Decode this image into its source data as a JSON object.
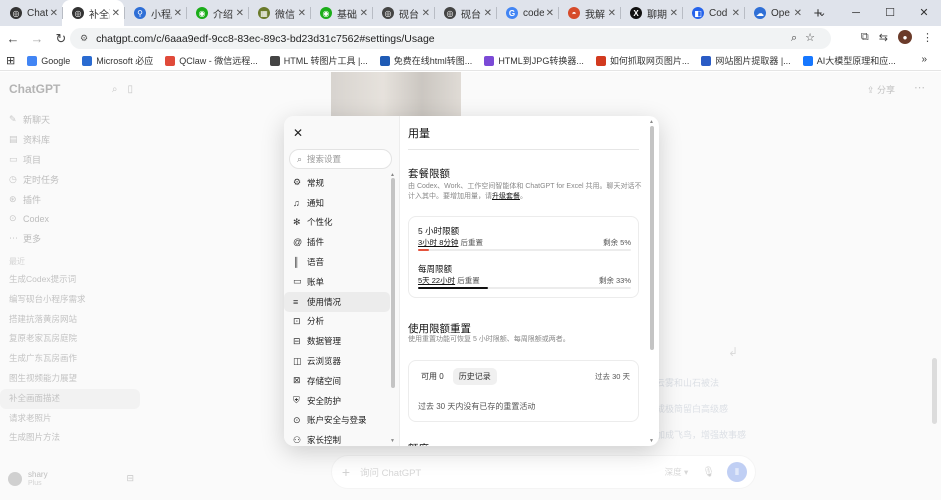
{
  "browser": {
    "tabs": [
      {
        "label": "Chat",
        "icon": "openai",
        "color": "#333333",
        "active": false
      },
      {
        "label": "补全副",
        "icon": "openai",
        "color": "#333333",
        "active": true
      },
      {
        "label": "小程序",
        "icon": "pin",
        "color": "#2f6fd6",
        "active": false
      },
      {
        "label": "介绍",
        "icon": "wechat",
        "color": "#1aad19",
        "active": false
      },
      {
        "label": "微信",
        "icon": "grid",
        "color": "#6a7a2a",
        "active": false
      },
      {
        "label": "基础",
        "icon": "wechat",
        "color": "#1aad19",
        "active": false
      },
      {
        "label": "砚台",
        "icon": "openai",
        "color": "#444444",
        "active": false
      },
      {
        "label": "砚台",
        "icon": "openai",
        "color": "#444444",
        "active": false
      },
      {
        "label": "code",
        "icon": "google",
        "color": "#4285f4",
        "active": false
      },
      {
        "label": "我解",
        "icon": "doc",
        "color": "#d64b2a",
        "active": false
      },
      {
        "label": "聊期",
        "icon": "x",
        "color": "#111111",
        "active": false
      },
      {
        "label": "Cod",
        "icon": "code",
        "color": "#2563eb",
        "active": false
      },
      {
        "label": "Ope",
        "icon": "cloud",
        "color": "#2f6fd6",
        "active": false
      }
    ],
    "new_tab": "+",
    "window_controls": [
      "─",
      "☐",
      "✕"
    ],
    "url": "chatgpt.com/c/6aaa9edf-9cc8-83ec-89c3-bd23d31c7562#settings/Usage",
    "bookmarks": [
      {
        "label": "Google",
        "color": "#4285f4"
      },
      {
        "label": "Microsoft 必应",
        "color": "#2a6bd1"
      },
      {
        "label": "QClaw - 微信远程...",
        "color": "#e04a3a"
      },
      {
        "label": "HTML 转图片工具 |...",
        "color": "#444444"
      },
      {
        "label": "免费在线html转图...",
        "color": "#1f5bb5"
      },
      {
        "label": "HTML到JPG转换器...",
        "color": "#7b4ad6"
      },
      {
        "label": "如何抓取网页图片...",
        "color": "#d23a1f"
      },
      {
        "label": "网站图片提取器 |...",
        "color": "#2a5bc5"
      },
      {
        "label": "AI大模型原理和应...",
        "color": "#1677ff"
      }
    ],
    "bookmarks_more": "»"
  },
  "sidebar": {
    "title": "ChatGPT",
    "nav": [
      {
        "label": "新聊天",
        "icon": "edit-icon"
      },
      {
        "label": "资料库",
        "icon": "library-icon"
      },
      {
        "label": "项目",
        "icon": "folder-icon"
      },
      {
        "label": "定时任务",
        "icon": "clock-icon"
      },
      {
        "label": "插件",
        "icon": "plugin-icon"
      },
      {
        "label": "Codex",
        "icon": "codex-icon"
      },
      {
        "label": "更多",
        "icon": "more-icon"
      }
    ],
    "recent_heading": "最近",
    "recent": [
      "生成Codex提示词",
      "编写砚台小程序需求",
      "搭建抗落黄房网站",
      "复原老家瓦房庭院",
      "生成广东瓦房画作",
      "图生视频能力展望",
      "补全画面描述",
      "请求老照片",
      "生成图片方法"
    ],
    "selected_recent": 6,
    "user": {
      "name": "shary",
      "plan": "Plus"
    }
  },
  "main": {
    "share_label": "分享",
    "chat_lines": [
      "云雾和山石被法",
      "成极简留白高级感",
      "加成飞鸟，增强故事感"
    ],
    "composer_placeholder": "询问 ChatGPT",
    "composer_mode": "深度 ▾"
  },
  "settings": {
    "search_placeholder": "搜索设置",
    "nav": [
      {
        "label": "常规",
        "icon": "gear-icon",
        "glyph": "⚙"
      },
      {
        "label": "通知",
        "icon": "bell-icon",
        "glyph": "♫"
      },
      {
        "label": "个性化",
        "icon": "sparkle-icon",
        "glyph": "✻"
      },
      {
        "label": "插件",
        "icon": "plugin-icon",
        "glyph": "@"
      },
      {
        "label": "语音",
        "icon": "waveform-icon",
        "glyph": "║"
      },
      {
        "label": "账单",
        "icon": "card-icon",
        "glyph": "▭"
      },
      {
        "label": "使用情况",
        "icon": "usage-icon",
        "glyph": "≡"
      },
      {
        "label": "分析",
        "icon": "chart-icon",
        "glyph": "⊡"
      },
      {
        "label": "数据管理",
        "icon": "database-icon",
        "glyph": "⊟"
      },
      {
        "label": "云浏览器",
        "icon": "cloud-browser-icon",
        "glyph": "◫"
      },
      {
        "label": "存储空间",
        "icon": "storage-icon",
        "glyph": "⊠"
      },
      {
        "label": "安全防护",
        "icon": "shield-icon",
        "glyph": "⛨"
      },
      {
        "label": "账户安全与登录",
        "icon": "lock-icon",
        "glyph": "⊙"
      },
      {
        "label": "家长控制",
        "icon": "family-icon",
        "glyph": "⚇"
      }
    ],
    "selected_index": 6,
    "title": "用量",
    "plan_limits": {
      "title": "套餐限额",
      "description": "由 Codex、Work、工作空间智能体和 ChatGPT for Excel 共用。聊天对话不计入其中。要增加用量，请",
      "upgrade_link": "升级套餐",
      "description_end": "。",
      "limits": [
        {
          "name": "5 小时限额",
          "reset_time": "3小时 8分钟",
          "reset_suffix": "后重置",
          "remaining": "剩余 5%",
          "remaining_fraction": 0.05,
          "bar_color": "#e5533d"
        },
        {
          "name": "每周限额",
          "reset_time": "5天 22小时",
          "reset_suffix": "后重置",
          "remaining": "剩余 33%",
          "remaining_fraction": 0.33,
          "bar_color": "#111111"
        }
      ]
    },
    "reset_section": {
      "title": "使用限额重置",
      "description": "使用重置功能可恢复 5 小时限额、每周限额或两者。",
      "tab_available": "可用 0",
      "tab_history": "历史记录",
      "period": "过去 30 天",
      "empty_text": "过去 30 天内没有已存的重置活动"
    },
    "next_section_title": "额度"
  }
}
